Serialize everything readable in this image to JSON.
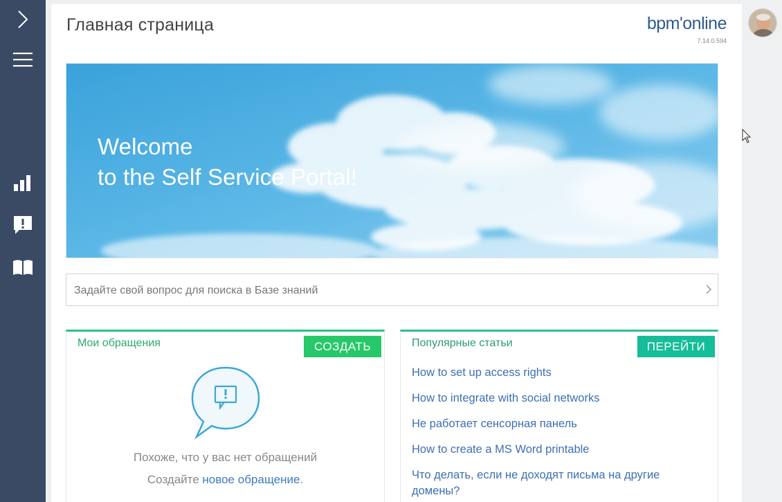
{
  "header": {
    "page_title": "Главная страница",
    "logo": "bpm'online",
    "version": "7.14.0.594"
  },
  "sidebar": {
    "items": [
      {
        "name": "expand",
        "icon": "chevron-right-icon"
      },
      {
        "name": "menu",
        "icon": "hamburger-icon"
      },
      {
        "name": "dashboards",
        "icon": "bar-chart-icon"
      },
      {
        "name": "cases",
        "icon": "speech-exclamation-icon"
      },
      {
        "name": "knowledge-base",
        "icon": "book-icon"
      }
    ]
  },
  "banner": {
    "line1": "Welcome",
    "line2": "to the Self Service Portal!"
  },
  "search": {
    "placeholder": "Задайте свой вопрос для поиска в Базе знаний"
  },
  "my_cases": {
    "title": "Мои обращения",
    "button": "СОЗДАТЬ",
    "empty_text": "Похоже, что у вас нет обращений",
    "cta_prefix": "Создайте ",
    "cta_link": "новое обращение",
    "cta_suffix": "."
  },
  "popular_articles": {
    "title": "Популярные статьи",
    "button": "ПЕРЕЙТИ",
    "items": [
      "How to set up access rights",
      "How to integrate with social networks",
      "Не работает сенсорная панель",
      "How to create a MS Word printable",
      "Что делать, если не доходят письма на другие домены?"
    ]
  },
  "colors": {
    "sidebar": "#3a4a64",
    "accent_green": "#27c869",
    "accent_teal": "#15bd9a",
    "link_blue": "#3d6fb4"
  }
}
